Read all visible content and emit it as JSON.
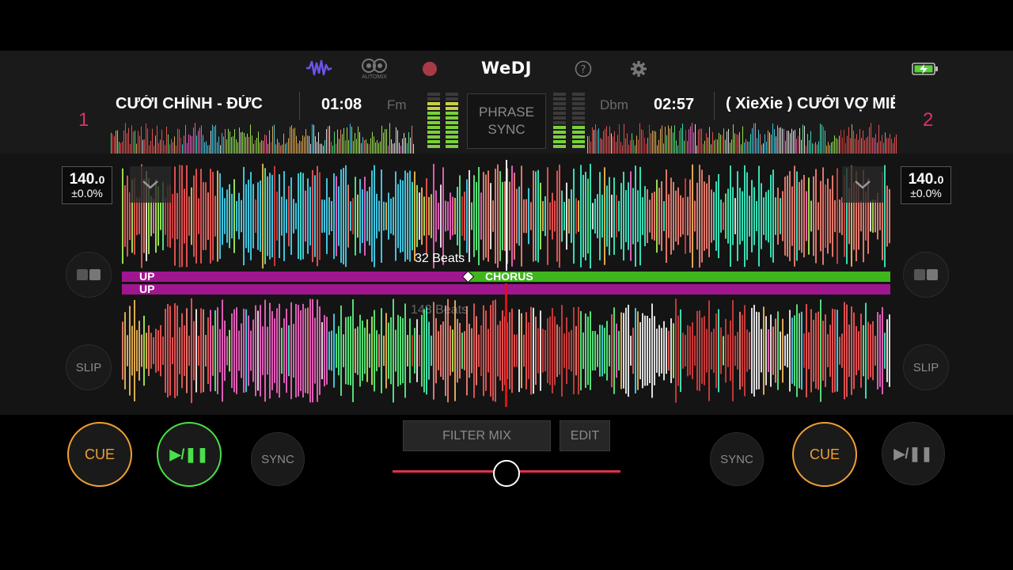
{
  "topbar": {
    "logo": "WeDJ",
    "automix_label": "AUTOMIX",
    "icons": [
      "waveform-icon",
      "automix-icon",
      "record-icon",
      "help-icon",
      "gear-icon",
      "battery-charging-icon"
    ]
  },
  "deck1": {
    "number": "1",
    "title": "CƯỚI CHÍNH - ĐỨC",
    "time": "01:08",
    "key": "Fm",
    "bpm_main": "140.",
    "bpm_decimal": "0",
    "pitch": "±0.0%",
    "cue_label": "CUE",
    "play_label": "▶/❚❚",
    "sync_label": "SYNC",
    "slip_label": "SLIP"
  },
  "deck2": {
    "number": "2",
    "title": "( XieXie ) CƯỚI VỢ MIỀN TÂY",
    "time": "02:57",
    "key": "Dbm",
    "bpm_main": "140.",
    "bpm_decimal": "0",
    "pitch": "±0.0%",
    "cue_label": "CUE",
    "play_label": "▶/❚❚",
    "sync_label": "SYNC",
    "slip_label": "SLIP"
  },
  "center": {
    "phrase_sync_line1": "PHRASE",
    "phrase_sync_line2": "SYNC",
    "filter_mix_label": "FILTER MIX",
    "edit_label": "EDIT",
    "crossfader_position": 0.5
  },
  "waveform": {
    "top_beats_label": "32 Beats",
    "bottom_beats_label": "143 Beats",
    "deck1_phrase_current": "UP",
    "deck1_phrase_next": "CHORUS",
    "deck2_phrase_current": "UP"
  },
  "colors": {
    "accent_pink": "#e0306a",
    "cue_orange": "#f0a033",
    "play_green": "#49e04a",
    "phrase_purple": "#a0168f",
    "phrase_green": "#3fb51d",
    "playhead_red": "#e01010"
  }
}
